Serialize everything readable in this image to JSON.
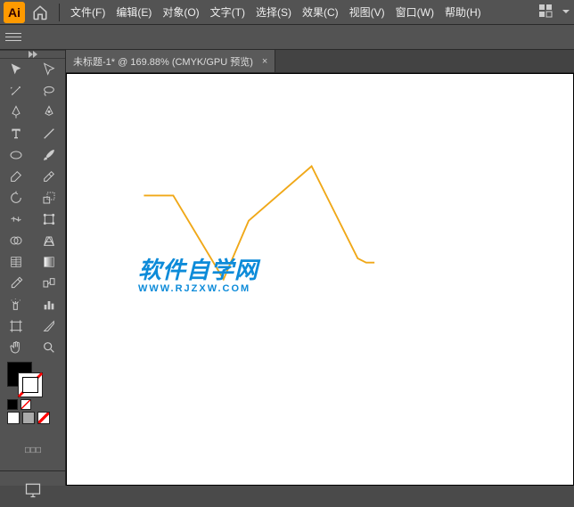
{
  "menubar": {
    "logo": "Ai",
    "items": [
      "文件(F)",
      "编辑(E)",
      "对象(O)",
      "文字(T)",
      "选择(S)",
      "效果(C)",
      "视图(V)",
      "窗口(W)",
      "帮助(H)"
    ]
  },
  "tabbar": {
    "tab_title": "未标题-1* @ 169.88% (CMYK/GPU 预览)",
    "close": "×"
  },
  "watermark": {
    "cn": "软件自学网",
    "en": "WWW.RJZXW.COM"
  },
  "tools": [
    "selection",
    "direct-selection",
    "magic-wand",
    "lasso",
    "pen",
    "curvature",
    "type",
    "line-segment",
    "ellipse",
    "paintbrush",
    "shaper",
    "eraser",
    "rotate",
    "scale",
    "width",
    "free-transform",
    "shape-builder",
    "perspective",
    "mesh",
    "gradient",
    "eyedropper",
    "blend",
    "symbol-sprayer",
    "column-graph",
    "artboard",
    "slice",
    "hand",
    "zoom"
  ]
}
